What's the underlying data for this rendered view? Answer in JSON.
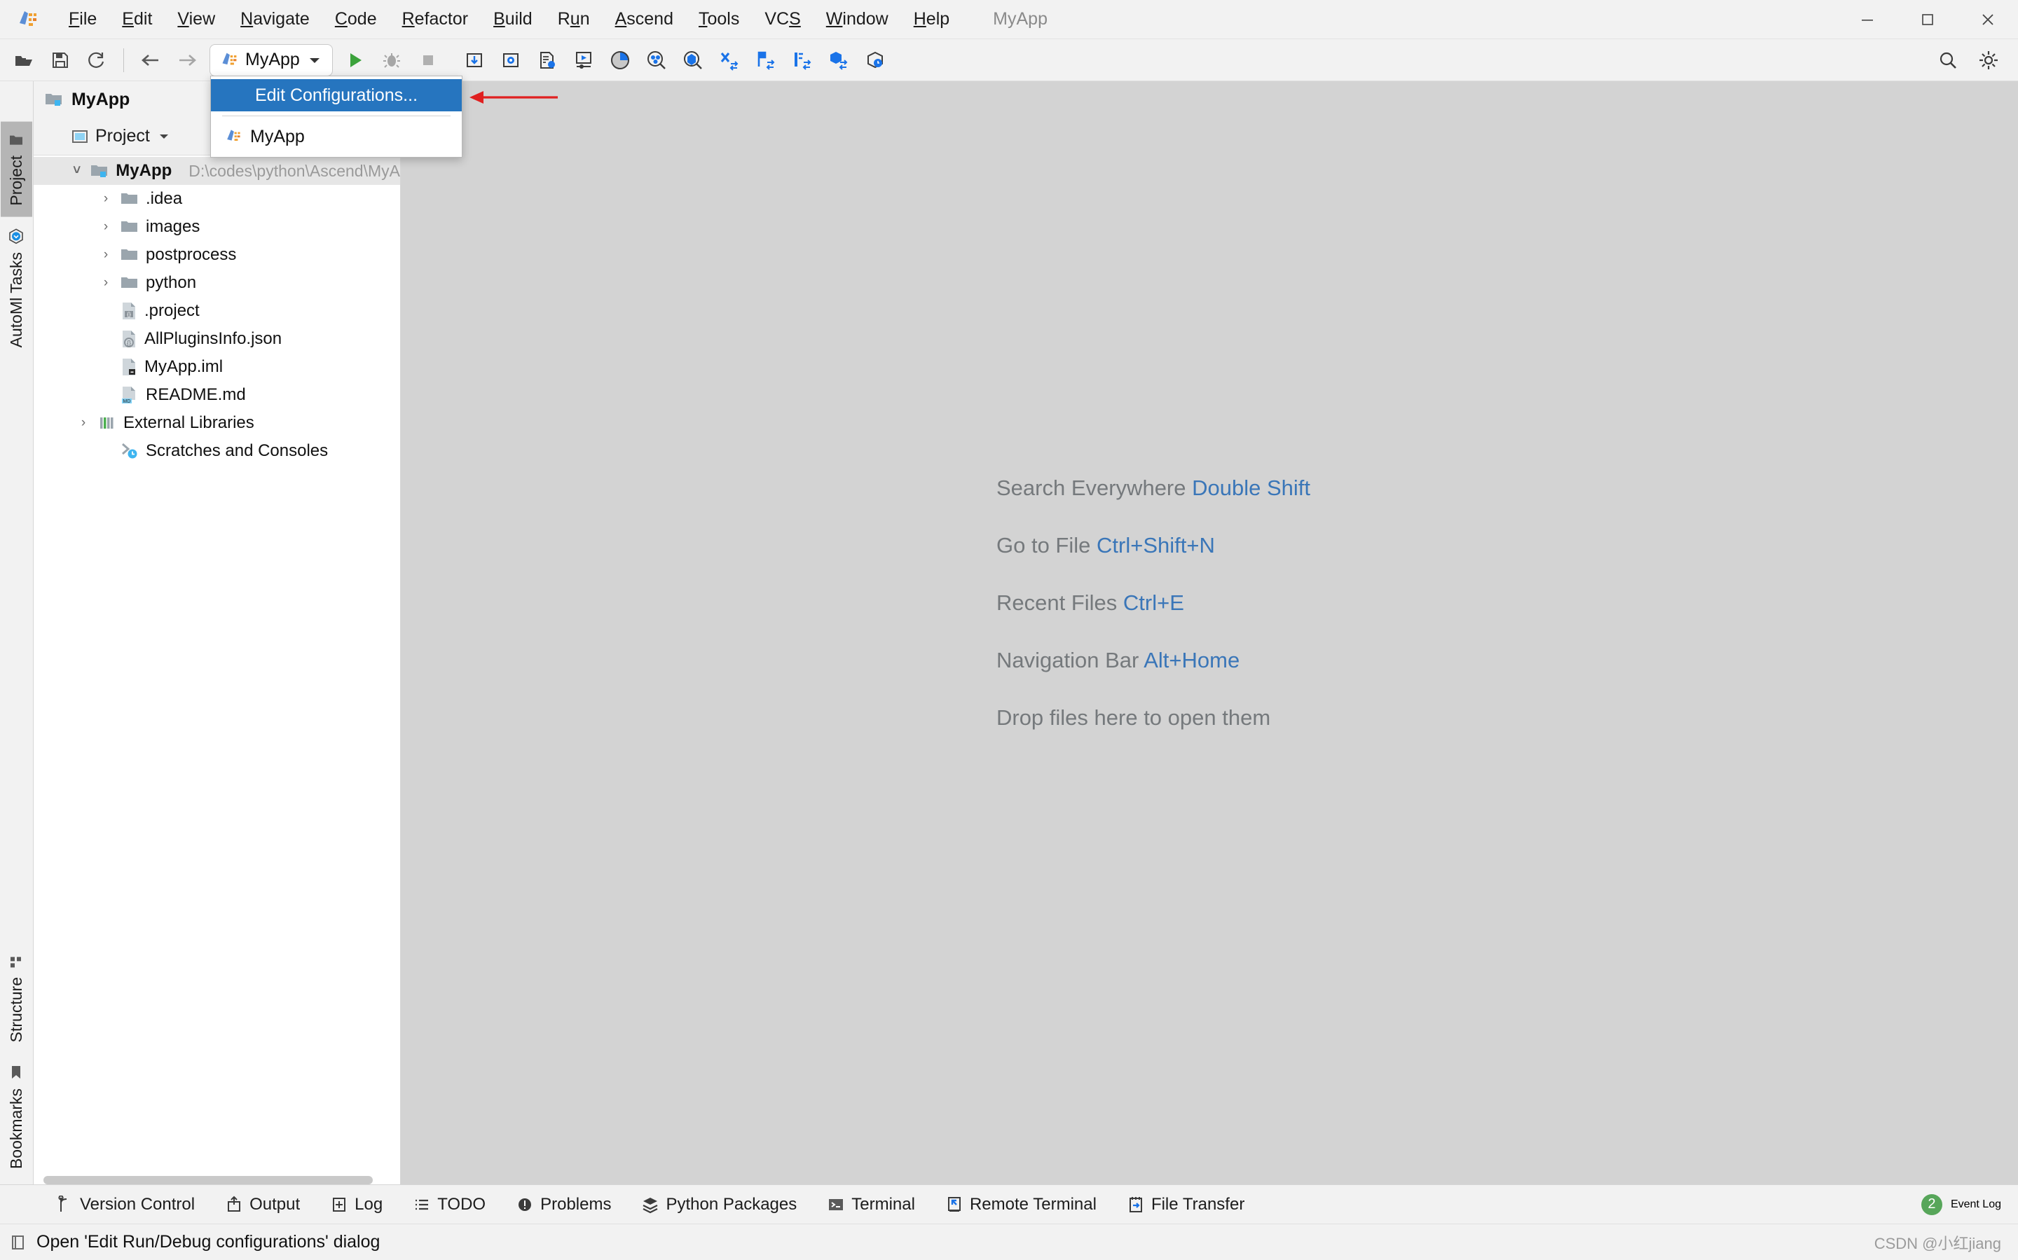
{
  "window": {
    "title": "MyApp",
    "controls": [
      "minimize",
      "maximize",
      "close"
    ]
  },
  "menubar": {
    "items": [
      {
        "label": "File",
        "mnemonic": "F"
      },
      {
        "label": "Edit",
        "mnemonic": "E"
      },
      {
        "label": "View",
        "mnemonic": "V"
      },
      {
        "label": "Navigate",
        "mnemonic": "N"
      },
      {
        "label": "Code",
        "mnemonic": "C"
      },
      {
        "label": "Refactor",
        "mnemonic": "R"
      },
      {
        "label": "Build",
        "mnemonic": "B"
      },
      {
        "label": "Run",
        "mnemonic": "u"
      },
      {
        "label": "Ascend",
        "mnemonic": "A"
      },
      {
        "label": "Tools",
        "mnemonic": "T"
      },
      {
        "label": "VCS",
        "mnemonic": "S"
      },
      {
        "label": "Window",
        "mnemonic": "W"
      },
      {
        "label": "Help",
        "mnemonic": "H"
      }
    ]
  },
  "toolbar": {
    "left_icons": [
      "open-folder-icon",
      "save-all-icon",
      "sync-refresh-icon"
    ],
    "nav_icons": [
      "back-arrow-icon",
      "forward-arrow-icon"
    ],
    "run_config": {
      "label": "MyApp",
      "icon": "ascend-app-icon",
      "dropdown_icon": "chevron-down-icon"
    },
    "run_icons": [
      "run-icon",
      "debug-icon",
      "stop-icon"
    ],
    "ascend_icons": [
      "download-package-icon",
      "settings-package-icon",
      "config-file-icon",
      "run-board-icon",
      "pie-chart-icon",
      "profiling-search-icon",
      "model-search-icon",
      "convert-x-icon",
      "compare-flag-icon",
      "compare-bar-icon",
      "model-convert-icon",
      "hex-clock-icon"
    ],
    "right_icons": [
      "search-icon",
      "gear-icon"
    ]
  },
  "run_config_popup": {
    "items": [
      {
        "label": "Edit Configurations...",
        "selected": true,
        "icon": null
      },
      {
        "label": "MyApp",
        "selected": false,
        "icon": "ascend-app-icon"
      }
    ]
  },
  "left_stripe": {
    "top_tabs": [
      {
        "label": "Project",
        "icon": "project-folder-icon",
        "active": true
      },
      {
        "label": "AutoMl Tasks",
        "icon": "automl-hex-icon",
        "active": false
      }
    ],
    "bottom_tabs": [
      {
        "label": "Structure",
        "icon": "structure-blocks-icon",
        "active": false
      },
      {
        "label": "Bookmarks",
        "icon": "bookmark-icon",
        "active": false
      }
    ]
  },
  "project_panel": {
    "title": "MyApp",
    "title_icon": "project-module-icon",
    "view_selector": {
      "label": "Project",
      "icon": "project-view-icon",
      "chevron": "chevron-down-icon"
    },
    "tree": [
      {
        "label": "MyApp",
        "path": "D:\\codes\\python\\Ascend\\MyA",
        "indent": 0,
        "expanded": true,
        "icon": "module-folder-icon",
        "bold": true,
        "selected": true
      },
      {
        "label": ".idea",
        "path": "",
        "indent": 1,
        "expanded": false,
        "icon": "folder-icon",
        "bold": false,
        "selected": false
      },
      {
        "label": "images",
        "path": "",
        "indent": 1,
        "expanded": false,
        "icon": "folder-icon",
        "bold": false,
        "selected": false
      },
      {
        "label": "postprocess",
        "path": "",
        "indent": 1,
        "expanded": false,
        "icon": "folder-icon",
        "bold": false,
        "selected": false
      },
      {
        "label": "python",
        "path": "",
        "indent": 1,
        "expanded": false,
        "icon": "folder-icon",
        "bold": false,
        "selected": false
      },
      {
        "label": ".project",
        "path": "",
        "indent": 1,
        "expanded": null,
        "icon": "xml-file-icon",
        "bold": false,
        "selected": false
      },
      {
        "label": "AllPluginsInfo.json",
        "path": "",
        "indent": 1,
        "expanded": null,
        "icon": "json-file-icon",
        "bold": false,
        "selected": false
      },
      {
        "label": "MyApp.iml",
        "path": "",
        "indent": 1,
        "expanded": null,
        "icon": "iml-file-icon",
        "bold": false,
        "selected": false
      },
      {
        "label": "README.md",
        "path": "",
        "indent": 1,
        "expanded": null,
        "icon": "markdown-file-icon",
        "bold": false,
        "selected": false
      },
      {
        "label": "External Libraries",
        "path": "",
        "indent": 0,
        "expanded": false,
        "icon": "libraries-icon",
        "bold": false,
        "selected": false
      },
      {
        "label": "Scratches and Consoles",
        "path": "",
        "indent": 0,
        "expanded": null,
        "icon": "scratches-icon",
        "bold": false,
        "selected": false
      }
    ]
  },
  "editor": {
    "hints": [
      {
        "action": "Search Everywhere",
        "shortcut": "Double Shift"
      },
      {
        "action": "Go to File",
        "shortcut": "Ctrl+Shift+N"
      },
      {
        "action": "Recent Files",
        "shortcut": "Ctrl+E"
      },
      {
        "action": "Navigation Bar",
        "shortcut": "Alt+Home"
      },
      {
        "action": "Drop files here to open them",
        "shortcut": ""
      }
    ]
  },
  "bottom_bar": {
    "items": [
      {
        "label": "Version Control",
        "icon": "branch-icon"
      },
      {
        "label": "Output",
        "icon": "output-arrow-icon"
      },
      {
        "label": "Log",
        "icon": "log-plus-icon"
      },
      {
        "label": "TODO",
        "icon": "todo-list-icon"
      },
      {
        "label": "Problems",
        "icon": "problems-icon"
      },
      {
        "label": "Python Packages",
        "icon": "packages-icon"
      },
      {
        "label": "Terminal",
        "icon": "terminal-icon"
      },
      {
        "label": "Remote Terminal",
        "icon": "remote-terminal-icon"
      },
      {
        "label": "File Transfer",
        "icon": "file-transfer-icon"
      }
    ],
    "event_log": {
      "label": "Event Log",
      "count": "2"
    }
  },
  "statusbar": {
    "icon": "tooltip-icon",
    "text": "Open 'Edit Run/Debug configurations' dialog",
    "watermark": "CSDN @小红jiang"
  },
  "colors": {
    "accent_blue": "#2675bf",
    "link_blue": "#3a76b8",
    "arrow_red": "#e02020",
    "badge_green": "#57a65a",
    "editor_bg": "#d3d3d3"
  }
}
